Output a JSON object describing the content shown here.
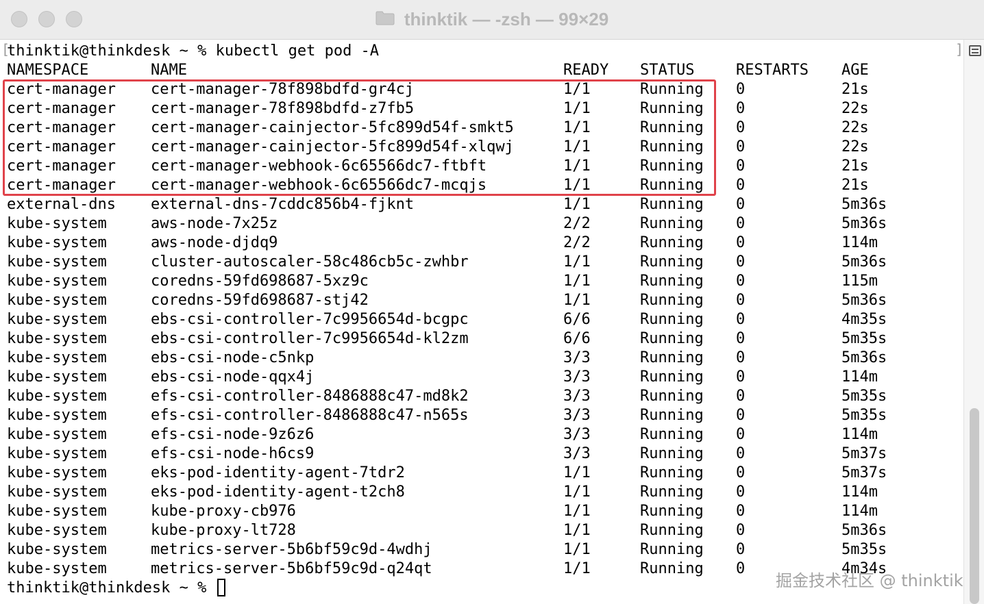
{
  "window": {
    "title": "thinktik — -zsh — 99×29",
    "folder_icon": "folder-icon"
  },
  "terminal": {
    "command_line": "thinktik@thinkdesk ~ % kubectl get pod -A",
    "headers": {
      "namespace": "NAMESPACE",
      "name": "NAME",
      "ready": "READY",
      "status": "STATUS",
      "restarts": "RESTARTS",
      "age": "AGE"
    },
    "rows": [
      {
        "namespace": "cert-manager",
        "name": "cert-manager-78f898bdfd-gr4cj",
        "ready": "1/1",
        "status": "Running",
        "restarts": "0",
        "age": "21s"
      },
      {
        "namespace": "cert-manager",
        "name": "cert-manager-78f898bdfd-z7fb5",
        "ready": "1/1",
        "status": "Running",
        "restarts": "0",
        "age": "22s"
      },
      {
        "namespace": "cert-manager",
        "name": "cert-manager-cainjector-5fc899d54f-smkt5",
        "ready": "1/1",
        "status": "Running",
        "restarts": "0",
        "age": "22s"
      },
      {
        "namespace": "cert-manager",
        "name": "cert-manager-cainjector-5fc899d54f-xlqwj",
        "ready": "1/1",
        "status": "Running",
        "restarts": "0",
        "age": "22s"
      },
      {
        "namespace": "cert-manager",
        "name": "cert-manager-webhook-6c65566dc7-ftbft",
        "ready": "1/1",
        "status": "Running",
        "restarts": "0",
        "age": "21s"
      },
      {
        "namespace": "cert-manager",
        "name": "cert-manager-webhook-6c65566dc7-mcqjs",
        "ready": "1/1",
        "status": "Running",
        "restarts": "0",
        "age": "21s"
      },
      {
        "namespace": "external-dns",
        "name": "external-dns-7cddc856b4-fjknt",
        "ready": "1/1",
        "status": "Running",
        "restarts": "0",
        "age": "5m36s"
      },
      {
        "namespace": "kube-system",
        "name": "aws-node-7x25z",
        "ready": "2/2",
        "status": "Running",
        "restarts": "0",
        "age": "5m36s"
      },
      {
        "namespace": "kube-system",
        "name": "aws-node-djdq9",
        "ready": "2/2",
        "status": "Running",
        "restarts": "0",
        "age": "114m"
      },
      {
        "namespace": "kube-system",
        "name": "cluster-autoscaler-58c486cb5c-zwhbr",
        "ready": "1/1",
        "status": "Running",
        "restarts": "0",
        "age": "5m36s"
      },
      {
        "namespace": "kube-system",
        "name": "coredns-59fd698687-5xz9c",
        "ready": "1/1",
        "status": "Running",
        "restarts": "0",
        "age": "115m"
      },
      {
        "namespace": "kube-system",
        "name": "coredns-59fd698687-stj42",
        "ready": "1/1",
        "status": "Running",
        "restarts": "0",
        "age": "5m36s"
      },
      {
        "namespace": "kube-system",
        "name": "ebs-csi-controller-7c9956654d-bcgpc",
        "ready": "6/6",
        "status": "Running",
        "restarts": "0",
        "age": "4m35s"
      },
      {
        "namespace": "kube-system",
        "name": "ebs-csi-controller-7c9956654d-kl2zm",
        "ready": "6/6",
        "status": "Running",
        "restarts": "0",
        "age": "5m35s"
      },
      {
        "namespace": "kube-system",
        "name": "ebs-csi-node-c5nkp",
        "ready": "3/3",
        "status": "Running",
        "restarts": "0",
        "age": "5m36s"
      },
      {
        "namespace": "kube-system",
        "name": "ebs-csi-node-qqx4j",
        "ready": "3/3",
        "status": "Running",
        "restarts": "0",
        "age": "114m"
      },
      {
        "namespace": "kube-system",
        "name": "efs-csi-controller-8486888c47-md8k2",
        "ready": "3/3",
        "status": "Running",
        "restarts": "0",
        "age": "5m35s"
      },
      {
        "namespace": "kube-system",
        "name": "efs-csi-controller-8486888c47-n565s",
        "ready": "3/3",
        "status": "Running",
        "restarts": "0",
        "age": "5m35s"
      },
      {
        "namespace": "kube-system",
        "name": "efs-csi-node-9z6z6",
        "ready": "3/3",
        "status": "Running",
        "restarts": "0",
        "age": "114m"
      },
      {
        "namespace": "kube-system",
        "name": "efs-csi-node-h6cs9",
        "ready": "3/3",
        "status": "Running",
        "restarts": "0",
        "age": "5m37s"
      },
      {
        "namespace": "kube-system",
        "name": "eks-pod-identity-agent-7tdr2",
        "ready": "1/1",
        "status": "Running",
        "restarts": "0",
        "age": "5m37s"
      },
      {
        "namespace": "kube-system",
        "name": "eks-pod-identity-agent-t2ch8",
        "ready": "1/1",
        "status": "Running",
        "restarts": "0",
        "age": "114m"
      },
      {
        "namespace": "kube-system",
        "name": "kube-proxy-cb976",
        "ready": "1/1",
        "status": "Running",
        "restarts": "0",
        "age": "114m"
      },
      {
        "namespace": "kube-system",
        "name": "kube-proxy-lt728",
        "ready": "1/1",
        "status": "Running",
        "restarts": "0",
        "age": "5m36s"
      },
      {
        "namespace": "kube-system",
        "name": "metrics-server-5b6bf59c9d-4wdhj",
        "ready": "1/1",
        "status": "Running",
        "restarts": "0",
        "age": "5m35s"
      },
      {
        "namespace": "kube-system",
        "name": "metrics-server-5b6bf59c9d-q24qt",
        "ready": "1/1",
        "status": "Running",
        "restarts": "0",
        "age": "4m34s"
      }
    ],
    "prompt": "thinktik@thinkdesk ~ % ",
    "highlight_color": "#e0424a"
  },
  "watermark": "掘金技术社区 @ thinktik"
}
